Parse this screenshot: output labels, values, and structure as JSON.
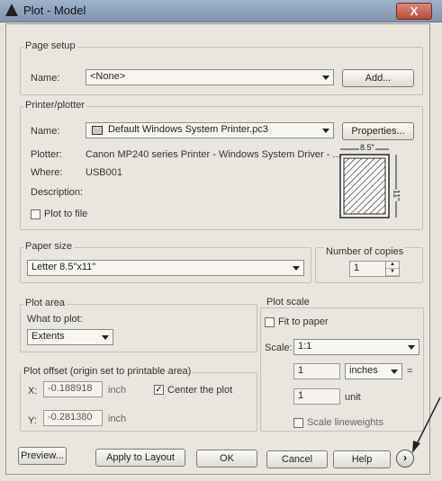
{
  "window": {
    "title": "Plot - Model",
    "close_label": "X"
  },
  "page_setup": {
    "legend": "Page setup",
    "name_label": "Name:",
    "name_value": "<None>",
    "add_button": "Add..."
  },
  "printer": {
    "legend": "Printer/plotter",
    "name_label": "Name:",
    "name_value": "Default Windows System Printer.pc3",
    "properties_button": "Properties...",
    "plotter_label": "Plotter:",
    "plotter_value": "Canon MP240 series Printer - Windows System Driver - ...",
    "where_label": "Where:",
    "where_value": "USB001",
    "description_label": "Description:",
    "plot_to_file_label": "Plot to file",
    "plot_to_file_checked": false,
    "preview_width_label": "8.5\"",
    "preview_height_label": "11\""
  },
  "paper_size": {
    "legend": "Paper size",
    "value": "Letter 8.5\"x11\""
  },
  "copies": {
    "legend": "Number of copies",
    "value": "1"
  },
  "plot_area": {
    "legend": "Plot area",
    "what_label": "What to plot:",
    "what_value": "Extents"
  },
  "plot_offset": {
    "legend": "Plot offset (origin set to printable area)",
    "x_label": "X:",
    "x_value": "-0.188918",
    "x_unit": "inch",
    "center_label": "Center the plot",
    "center_checked": true,
    "y_label": "Y:",
    "y_value": "-0.281380",
    "y_unit": "inch"
  },
  "plot_scale": {
    "legend": "Plot scale",
    "fit_label": "Fit to paper",
    "fit_checked": false,
    "scale_label": "Scale:",
    "scale_value": "1:1",
    "value1": "1",
    "units_value": "inches",
    "equals": "=",
    "value2": "1",
    "unit_label": "unit",
    "lineweights_label": "Scale lineweights",
    "lineweights_checked": false
  },
  "footer": {
    "preview_button": "Preview...",
    "apply_button": "Apply to Layout",
    "ok_button": "OK",
    "cancel_button": "Cancel",
    "help_button": "Help",
    "more_options_icon": "chevron-right-circle-icon"
  }
}
